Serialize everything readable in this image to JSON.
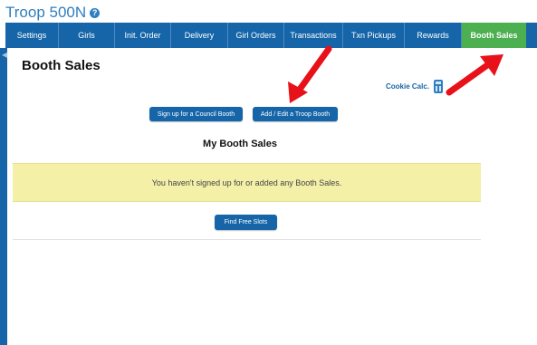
{
  "header": {
    "title": "Troop 500N",
    "help_icon": "help-icon"
  },
  "nav": {
    "items": [
      {
        "label": "Settings"
      },
      {
        "label": "Girls"
      },
      {
        "label": "Init. Order"
      },
      {
        "label": "Delivery"
      },
      {
        "label": "Girl Orders"
      },
      {
        "label": "Transactions"
      },
      {
        "label": "Txn Pickups"
      },
      {
        "label": "Rewards"
      },
      {
        "label": "Booth Sales",
        "active": true
      }
    ],
    "colors": {
      "bar": "#1565a8",
      "active": "#4caf50"
    }
  },
  "page": {
    "title": "Booth Sales",
    "cookie_calc_label": "Cookie Calc.",
    "calc_icon": "calculator-icon",
    "buttons": {
      "council": "Sign up for a Council Booth",
      "troop": "Add / Edit a Troop Booth",
      "free_slots": "Find Free Slots"
    },
    "section_title": "My Booth Sales",
    "notice": "You haven't signed up for or added any Booth Sales."
  },
  "annotations": {
    "arrow_color": "#e8111a"
  }
}
